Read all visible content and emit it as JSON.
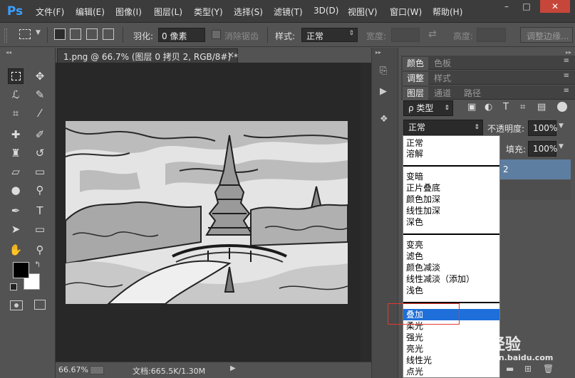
{
  "app": {
    "logo": "Ps"
  },
  "menu": [
    "文件(F)",
    "编辑(E)",
    "图像(I)",
    "图层(L)",
    "类型(Y)",
    "选择(S)",
    "滤镜(T)",
    "3D(D)",
    "视图(V)",
    "窗口(W)",
    "帮助(H)"
  ],
  "window_controls": {
    "minimize": "–",
    "maximize": "□",
    "close": "✕"
  },
  "options": {
    "feather_label": "羽化:",
    "feather_value": "0 像素",
    "antialias_label": "消除锯齿",
    "style_label": "样式:",
    "style_value": "正常",
    "width_label": "宽度:",
    "height_label": "高度:",
    "refine_edge": "调整边缘..."
  },
  "document": {
    "tab_title": "1.png @ 66.7% (图层 0 拷贝 2, RGB/8#) *",
    "tab_close": "×",
    "zoom": "66.67%",
    "doc_info": "文档:665.5K/1.30M"
  },
  "panels": {
    "row1": [
      "颜色",
      "色板"
    ],
    "row2": [
      "调整",
      "样式"
    ],
    "row3": [
      "图层",
      "通道",
      "路径"
    ],
    "filter_kind": "ρ 类型",
    "blend_mode": "正常",
    "opacity_label": "不透明度:",
    "opacity_value": "100%",
    "fill_label": "填充:",
    "fill_value": "100%",
    "layer_suffix": "2"
  },
  "blend_modes": {
    "group1": [
      "正常",
      "溶解"
    ],
    "group2": [
      "变暗",
      "正片叠底",
      "颜色加深",
      "线性加深",
      "深色"
    ],
    "group3": [
      "变亮",
      "滤色",
      "颜色减淡",
      "线性减淡（添加）",
      "浅色"
    ],
    "group4": [
      "叠加",
      "柔光",
      "强光",
      "亮光",
      "线性光",
      "点光"
    ],
    "selected": "叠加"
  },
  "watermark": {
    "brand": "Bai 经验",
    "url": "jingyan.baidu.com"
  },
  "colors": {
    "selected_blue": "#1e6fd9",
    "highlight_red": "#e03a2e",
    "ps_blue": "#3aa0ff"
  }
}
